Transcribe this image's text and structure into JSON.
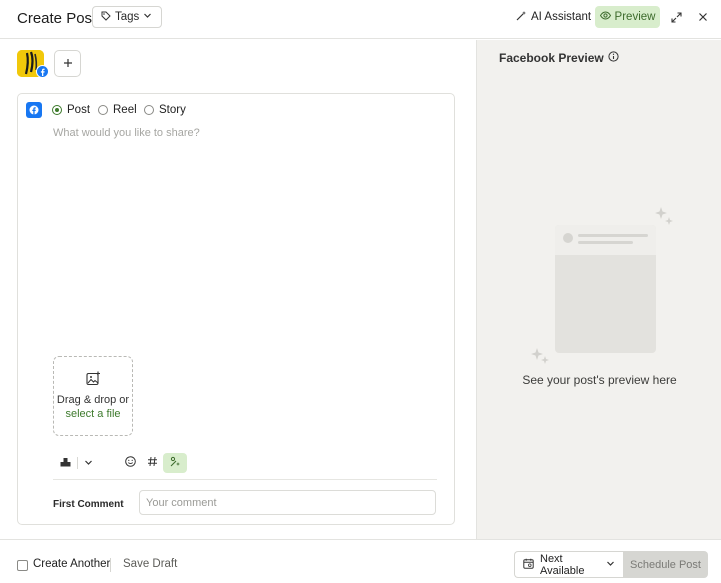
{
  "header": {
    "title": "Create Post",
    "tags_label": "Tags",
    "ai_label": "AI Assistant",
    "preview_label": "Preview"
  },
  "post_type": {
    "options": [
      "Post",
      "Reel",
      "Story"
    ],
    "selected": "Post"
  },
  "composer": {
    "placeholder": "What would you like to share?"
  },
  "dropzone": {
    "line1": "Drag & drop or",
    "line2": "select a file"
  },
  "first_comment": {
    "label": "First Comment",
    "placeholder": "Your comment"
  },
  "preview_panel": {
    "title": "Facebook Preview",
    "empty_text": "See your post's preview here"
  },
  "footer": {
    "create_another": "Create Another",
    "save_draft": "Save Draft",
    "next_available": "Next Available",
    "schedule": "Schedule Post"
  },
  "colors": {
    "accent_green": "#3d7a2c",
    "accent_green_bg": "#d8edcc",
    "facebook_blue": "#1877f2",
    "avatar_yellow": "#f1c80a",
    "panel_bg": "#f2f1ee"
  },
  "icons": {
    "tags": "tag-icon",
    "ai": "magic-wand-icon",
    "preview": "eye-icon",
    "expand": "expand-icon",
    "close": "close-icon",
    "upload": "image-plus-icon",
    "info": "info-icon",
    "calendar": "calendar-icon"
  }
}
